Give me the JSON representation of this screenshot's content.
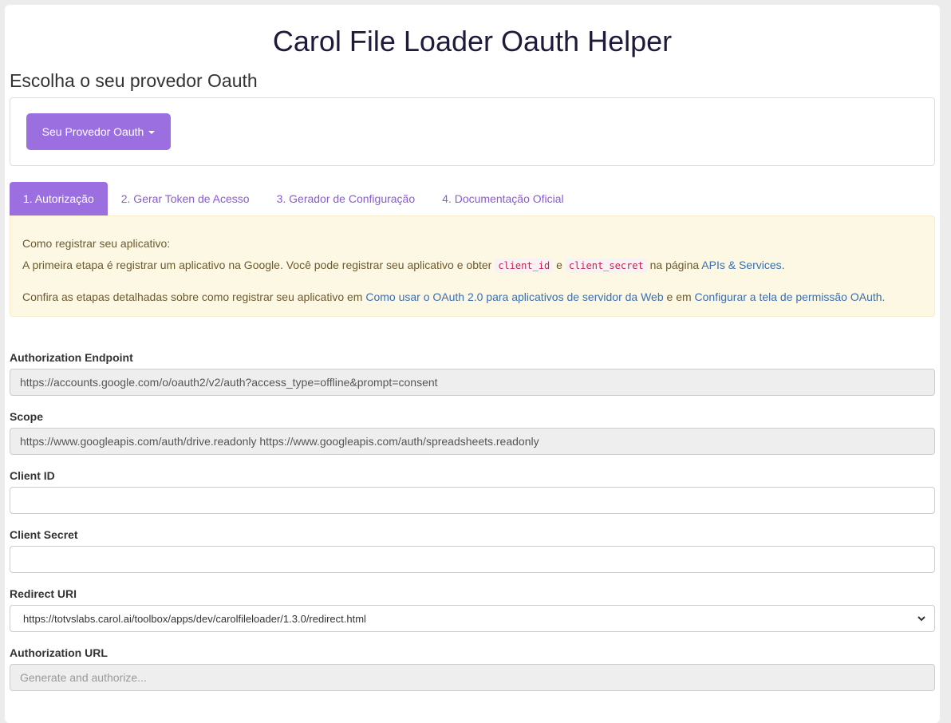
{
  "page": {
    "title": "Carol File Loader Oauth Helper",
    "provider_heading": "Escolha o seu provedor Oauth",
    "provider_button": "Seu Provedor Oauth"
  },
  "tabs": [
    {
      "label": "1. Autorização",
      "active": true
    },
    {
      "label": "2. Gerar Token de Acesso",
      "active": false
    },
    {
      "label": "3. Gerador de Configuração",
      "active": false
    },
    {
      "label": "4. Documentação Oficial",
      "active": false
    }
  ],
  "alert": {
    "line1": "Como registrar seu aplicativo:",
    "line2_a": "A primeira etapa é registrar um aplicativo na Google. Você pode registrar seu aplicativo e obter ",
    "code1": "client_id",
    "line2_b": " e ",
    "code2": "client_secret",
    "line2_c": " na página ",
    "link1": "APIs & Services",
    "line2_d": ".",
    "line3_a": "Confira as etapas detalhadas sobre como registrar seu aplicativo em ",
    "link2": "Como usar o OAuth 2.0 para aplicativos de servidor da Web",
    "line3_b": " e em ",
    "link3": "Configurar a tela de permissão OAuth",
    "line3_c": "."
  },
  "fields": {
    "auth_endpoint": {
      "label": "Authorization Endpoint",
      "value": "https://accounts.google.com/o/oauth2/v2/auth?access_type=offline&prompt=consent"
    },
    "scope": {
      "label": "Scope",
      "value": "https://www.googleapis.com/auth/drive.readonly https://www.googleapis.com/auth/spreadsheets.readonly"
    },
    "client_id": {
      "label": "Client ID",
      "value": ""
    },
    "client_secret": {
      "label": "Client Secret",
      "value": ""
    },
    "redirect_uri": {
      "label": "Redirect URI",
      "value": "https://totvslabs.carol.ai/toolbox/apps/dev/carolfileloader/1.3.0/redirect.html"
    },
    "auth_url": {
      "label": "Authorization URL",
      "placeholder": "Generate and authorize..."
    }
  },
  "colors": {
    "accent": "#9b6fe0",
    "link": "#3a6fb0",
    "alert_bg": "#fcf8e3"
  }
}
